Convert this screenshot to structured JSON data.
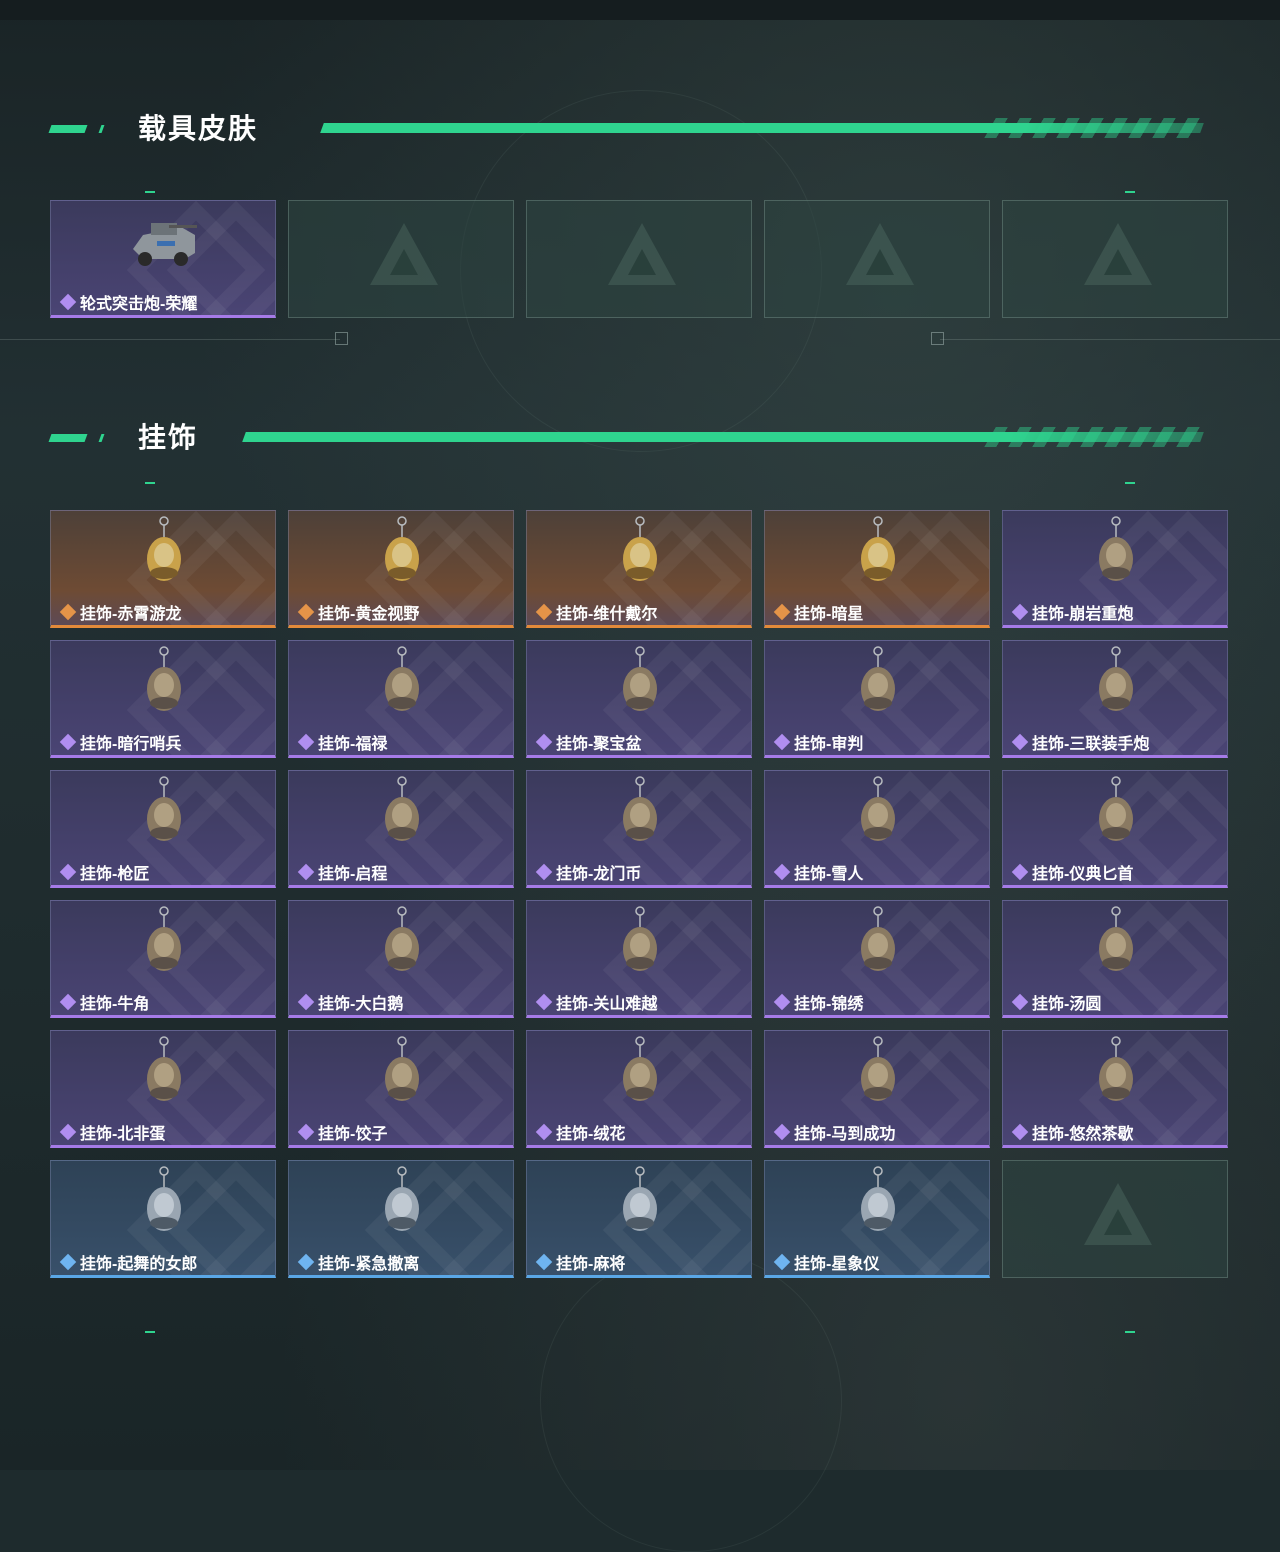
{
  "sections": [
    {
      "title": "载具皮肤",
      "items": [
        {
          "name": "轮式突击炮-荣耀",
          "rarity": "purple",
          "icon": "armored-vehicle-icon"
        },
        {
          "name": "",
          "rarity": "empty"
        },
        {
          "name": "",
          "rarity": "empty"
        },
        {
          "name": "",
          "rarity": "empty"
        },
        {
          "name": "",
          "rarity": "empty"
        }
      ]
    },
    {
      "title": "挂饰",
      "items": [
        {
          "name": "挂饰-赤霄游龙",
          "rarity": "orange",
          "icon": "dragon-figure-icon"
        },
        {
          "name": "挂饰-黄金视野",
          "rarity": "orange",
          "icon": "golden-figure-icon"
        },
        {
          "name": "挂饰-维什戴尔",
          "rarity": "orange",
          "icon": "card-charm-icon"
        },
        {
          "name": "挂饰-暗星",
          "rarity": "orange",
          "icon": "dark-star-icon"
        },
        {
          "name": "挂饰-崩岩重炮",
          "rarity": "purple",
          "icon": "rock-figure-icon"
        },
        {
          "name": "挂饰-暗行哨兵",
          "rarity": "purple",
          "icon": "sentinel-figure-icon"
        },
        {
          "name": "挂饰-福禄",
          "rarity": "purple",
          "icon": "gourd-charm-icon"
        },
        {
          "name": "挂饰-聚宝盆",
          "rarity": "purple",
          "icon": "treasure-bowl-icon"
        },
        {
          "name": "挂饰-审判",
          "rarity": "purple",
          "icon": "tarot-card-icon"
        },
        {
          "name": "挂饰-三联装手炮",
          "rarity": "purple",
          "icon": "hand-cannon-icon"
        },
        {
          "name": "挂饰-枪匠",
          "rarity": "purple",
          "icon": "gunsmith-box-icon"
        },
        {
          "name": "挂饰-启程",
          "rarity": "purple",
          "icon": "medallion-icon"
        },
        {
          "name": "挂饰-龙门币",
          "rarity": "purple",
          "icon": "coin-tag-icon"
        },
        {
          "name": "挂饰-雪人",
          "rarity": "purple",
          "icon": "snowman-icon"
        },
        {
          "name": "挂饰-仪典匕首",
          "rarity": "purple",
          "icon": "dagger-icon"
        },
        {
          "name": "挂饰-牛角",
          "rarity": "purple",
          "icon": "bull-horn-icon"
        },
        {
          "name": "挂饰-大白鹅",
          "rarity": "purple",
          "icon": "goose-icon"
        },
        {
          "name": "挂饰-关山难越",
          "rarity": "purple",
          "icon": "gold-bar-icon"
        },
        {
          "name": "挂饰-锦绣",
          "rarity": "purple",
          "icon": "butterfly-icon"
        },
        {
          "name": "挂饰-汤圆",
          "rarity": "purple",
          "icon": "rice-ball-bowl-icon"
        },
        {
          "name": "挂饰-北非蛋",
          "rarity": "purple",
          "icon": "egg-dish-icon"
        },
        {
          "name": "挂饰-饺子",
          "rarity": "purple",
          "icon": "dumpling-icon"
        },
        {
          "name": "挂饰-绒花",
          "rarity": "purple",
          "icon": "velvet-flower-icon"
        },
        {
          "name": "挂饰-马到成功",
          "rarity": "purple",
          "icon": "red-horse-icon"
        },
        {
          "name": "挂饰-悠然茶歇",
          "rarity": "purple",
          "icon": "cupcake-icon"
        },
        {
          "name": "挂饰-起舞的女郎",
          "rarity": "blue",
          "icon": "dancer-icon"
        },
        {
          "name": "挂饰-紧急撤离",
          "rarity": "blue",
          "icon": "skull-tag-icon"
        },
        {
          "name": "挂饰-麻将",
          "rarity": "blue",
          "icon": "mahjong-tile-icon"
        },
        {
          "name": "挂饰-星象仪",
          "rarity": "blue",
          "icon": "astrolabe-icon"
        },
        {
          "name": "",
          "rarity": "empty"
        }
      ]
    }
  ],
  "colors": {
    "accent": "#2fd48f",
    "rarity_orange": "#e38a3a",
    "rarity_purple": "#a67be8",
    "rarity_blue": "#5aa7e6"
  }
}
